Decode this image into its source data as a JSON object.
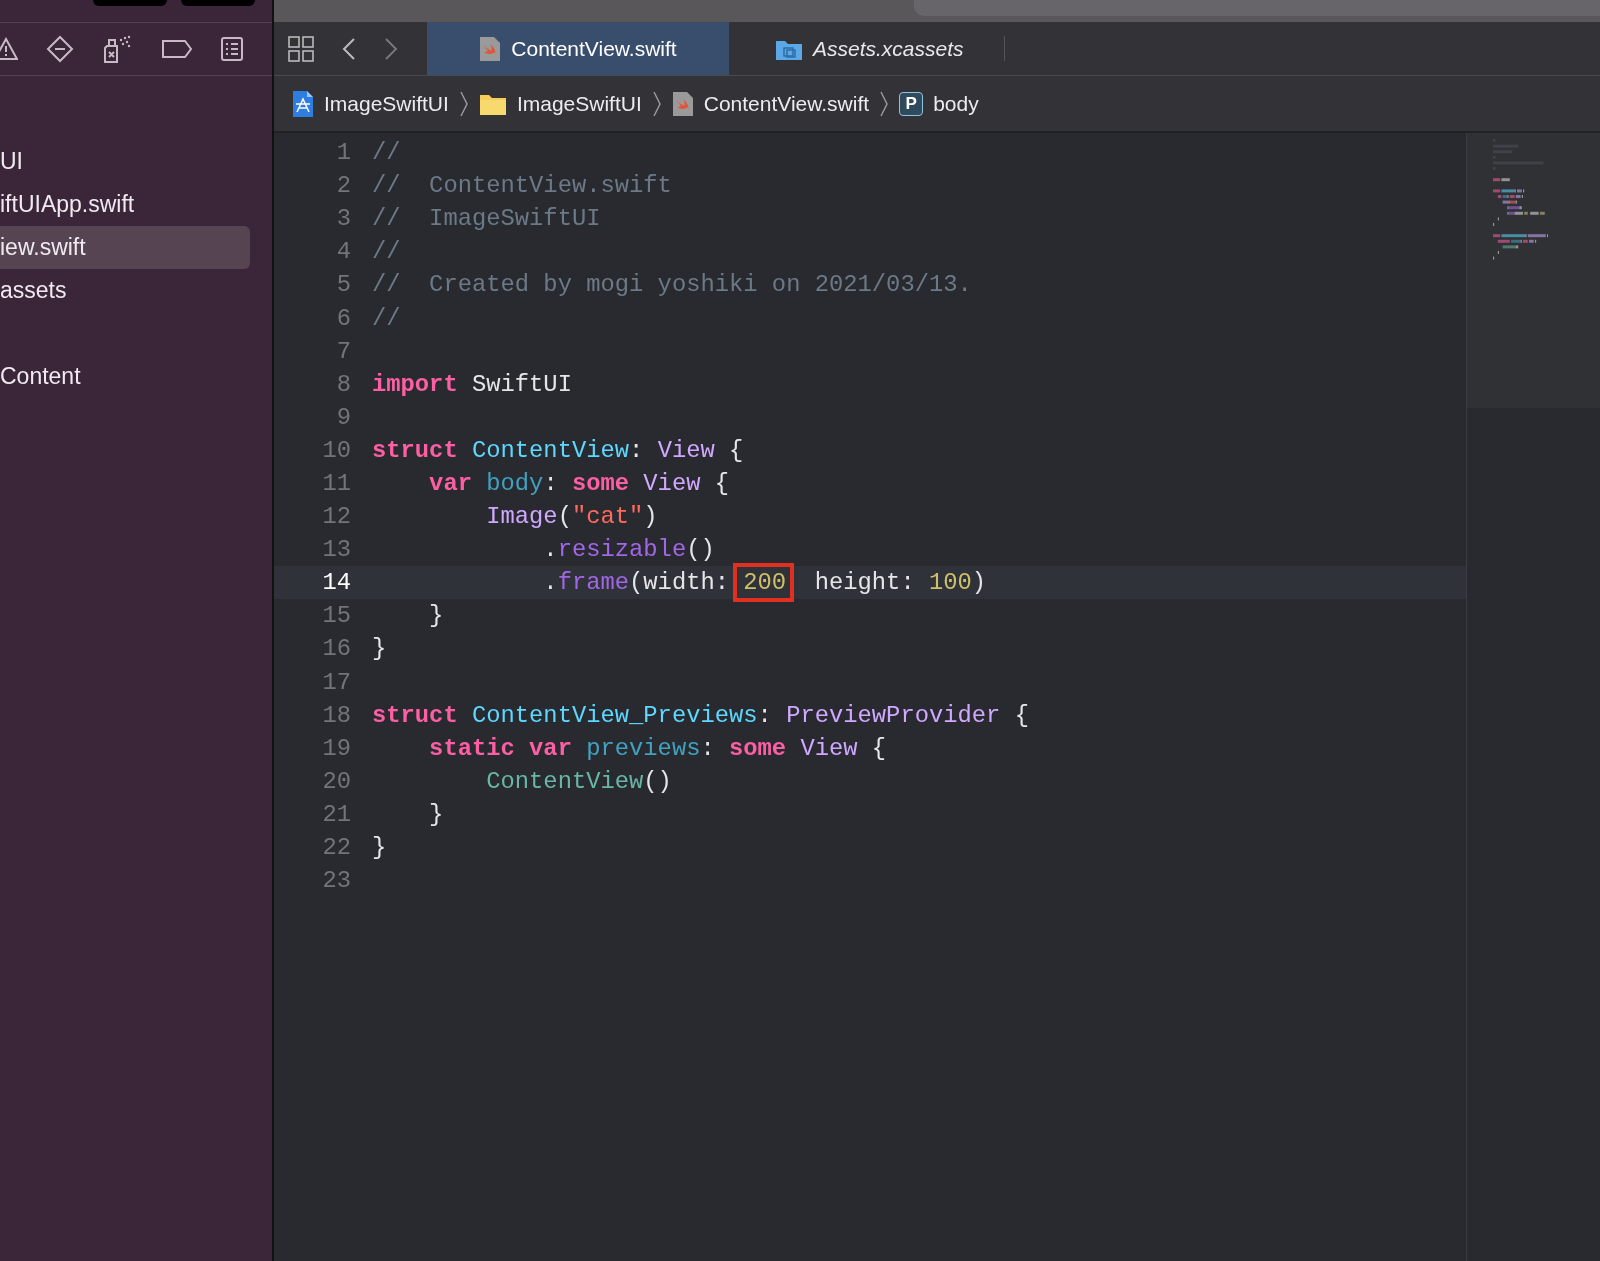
{
  "sidebar": {
    "groups": [
      {
        "items": [
          {
            "label": "UI",
            "selected": false
          },
          {
            "label": "iftUIApp.swift",
            "selected": false
          },
          {
            "label": "iew.swift",
            "selected": true
          },
          {
            "label": "assets",
            "selected": false
          }
        ]
      },
      {
        "items": [
          {
            "label": "Content",
            "selected": false
          }
        ]
      }
    ]
  },
  "tabs": [
    {
      "label": "ContentView.swift",
      "kind": "swift",
      "selected": true
    },
    {
      "label": "Assets.xcassets",
      "kind": "assets",
      "selected": false
    }
  ],
  "breadcrumbs": [
    {
      "label": "ImageSwiftUI",
      "kind": "project"
    },
    {
      "label": "ImageSwiftUI",
      "kind": "folder"
    },
    {
      "label": "ContentView.swift",
      "kind": "swift"
    },
    {
      "label": "body",
      "kind": "property",
      "badge": "P"
    }
  ],
  "editor": {
    "lines": [
      {
        "number": "1",
        "current": false,
        "tokens": [
          {
            "kind": "comment",
            "text": "//"
          }
        ]
      },
      {
        "number": "2",
        "current": false,
        "tokens": [
          {
            "kind": "comment",
            "text": "//  ContentView.swift"
          }
        ]
      },
      {
        "number": "3",
        "current": false,
        "tokens": [
          {
            "kind": "comment",
            "text": "//  ImageSwiftUI"
          }
        ]
      },
      {
        "number": "4",
        "current": false,
        "tokens": [
          {
            "kind": "comment",
            "text": "//"
          }
        ]
      },
      {
        "number": "5",
        "current": false,
        "tokens": [
          {
            "kind": "comment",
            "text": "//  Created by mogi yoshiki on 2021/03/13."
          }
        ]
      },
      {
        "number": "6",
        "current": false,
        "tokens": [
          {
            "kind": "comment",
            "text": "//"
          }
        ]
      },
      {
        "number": "7",
        "current": false
      },
      {
        "number": "8",
        "current": false,
        "tokens": [
          {
            "kind": "keyword",
            "text": "import"
          },
          {
            "kind": "plain",
            "text": " SwiftUI"
          }
        ]
      },
      {
        "number": "9",
        "current": false
      },
      {
        "number": "10",
        "current": false,
        "tokens": [
          {
            "kind": "keyword",
            "text": "struct"
          },
          {
            "kind": "decl",
            "text": " ContentView"
          },
          {
            "kind": "plain",
            "text": ": "
          },
          {
            "kind": "type",
            "text": "View"
          },
          {
            "kind": "plain",
            "text": " {"
          }
        ]
      },
      {
        "number": "11",
        "current": false,
        "tokens": [
          {
            "kind": "keyword",
            "text": "    var"
          },
          {
            "kind": "member",
            "text": " body"
          },
          {
            "kind": "plain",
            "text": ": "
          },
          {
            "kind": "keyword",
            "text": "some"
          },
          {
            "kind": "type",
            "text": " View"
          },
          {
            "kind": "plain",
            "text": " {"
          }
        ]
      },
      {
        "number": "12",
        "current": false,
        "tokens": [
          {
            "kind": "type",
            "text": "        Image"
          },
          {
            "kind": "plain",
            "text": "("
          },
          {
            "kind": "string",
            "text": "\"cat\""
          },
          {
            "kind": "plain",
            "text": ")"
          }
        ]
      },
      {
        "number": "13",
        "current": false,
        "tokens": [
          {
            "kind": "plain",
            "text": "            ."
          },
          {
            "kind": "method",
            "text": "resizable"
          },
          {
            "kind": "plain",
            "text": "()"
          }
        ]
      },
      {
        "number": "14",
        "current": true,
        "tokens": [
          {
            "kind": "plain",
            "text": "            ."
          },
          {
            "kind": "method",
            "text": "frame"
          },
          {
            "kind": "plain",
            "text": "(width: "
          },
          {
            "kind": "number",
            "text": "200",
            "boxed": true
          },
          {
            "kind": "plain",
            "text": "  height: "
          },
          {
            "kind": "number",
            "text": "100"
          },
          {
            "kind": "plain",
            "text": ")"
          }
        ]
      },
      {
        "number": "15",
        "current": false,
        "tokens": [
          {
            "kind": "plain",
            "text": "    }"
          }
        ]
      },
      {
        "number": "16",
        "current": false,
        "tokens": [
          {
            "kind": "plain",
            "text": "}"
          }
        ]
      },
      {
        "number": "17",
        "current": false
      },
      {
        "number": "18",
        "current": false,
        "tokens": [
          {
            "kind": "keyword",
            "text": "struct"
          },
          {
            "kind": "decl",
            "text": " ContentView_Previews"
          },
          {
            "kind": "plain",
            "text": ": "
          },
          {
            "kind": "type",
            "text": "PreviewProvider"
          },
          {
            "kind": "plain",
            "text": " {"
          }
        ]
      },
      {
        "number": "19",
        "current": false,
        "tokens": [
          {
            "kind": "keyword",
            "text": "    static var"
          },
          {
            "kind": "member",
            "text": " previews"
          },
          {
            "kind": "plain",
            "text": ": "
          },
          {
            "kind": "keyword",
            "text": "some"
          },
          {
            "kind": "type",
            "text": " View"
          },
          {
            "kind": "plain",
            "text": " {"
          }
        ]
      },
      {
        "number": "20",
        "current": false,
        "tokens": [
          {
            "kind": "project",
            "text": "        ContentView"
          },
          {
            "kind": "plain",
            "text": "()"
          }
        ]
      },
      {
        "number": "21",
        "current": false,
        "tokens": [
          {
            "kind": "plain",
            "text": "    }"
          }
        ]
      },
      {
        "number": "22",
        "current": false,
        "tokens": [
          {
            "kind": "plain",
            "text": "}"
          }
        ]
      },
      {
        "number": "23",
        "current": false
      }
    ]
  }
}
